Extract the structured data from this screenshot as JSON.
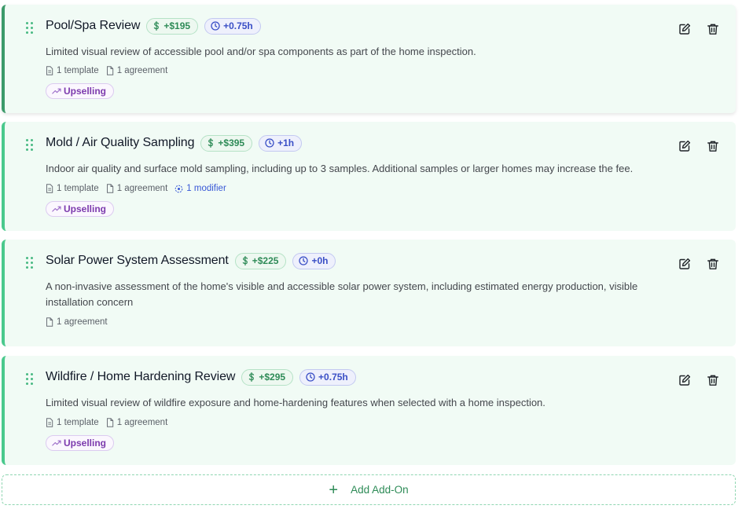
{
  "addons": [
    {
      "title": "Pool/Spa Review",
      "price": "+$195",
      "time": "+0.75h",
      "description": "Limited visual review of accessible pool and/or spa components as part of the home inspection.",
      "templates": "1 template",
      "agreements": "1 agreement",
      "modifiers": null,
      "tag": "Upselling"
    },
    {
      "title": "Mold / Air Quality Sampling",
      "price": "+$395",
      "time": "+1h",
      "description": "Indoor air quality and surface mold sampling, including up to 3 samples. Additional samples or larger homes may increase the fee.",
      "templates": "1 template",
      "agreements": "1 agreement",
      "modifiers": "1 modifier",
      "tag": "Upselling"
    },
    {
      "title": "Solar Power System Assessment",
      "price": "+$225",
      "time": "+0h",
      "description": "A non-invasive assessment of the home's visible and accessible solar power system, including estimated energy production, visible installation concern",
      "templates": null,
      "agreements": "1 agreement",
      "modifiers": null,
      "tag": null
    },
    {
      "title": "Wildfire / Home Hardening Review",
      "price": "+$295",
      "time": "+0.75h",
      "description": "Limited visual review of wildfire exposure and home-hardening features when selected with a home inspection.",
      "templates": "1 template",
      "agreements": "1 agreement",
      "modifiers": null,
      "tag": "Upselling"
    }
  ],
  "add_button_label": "Add Add-On",
  "icons": {
    "drag": "drag-handle-icon",
    "price": "dollar-icon",
    "time": "clock-icon",
    "template": "document-icon",
    "agreement": "file-icon",
    "modifier": "modifier-icon",
    "tag": "trending-up-icon",
    "edit": "edit-icon",
    "delete": "trash-icon",
    "add": "plus-icon"
  },
  "colors": {
    "card_bg": "#f1fbf5",
    "card_accent": "#4ac98d",
    "price_text": "#2e8b57",
    "time_text": "#3a4fc6",
    "tag_text": "#7c3aad",
    "modifier_text": "#3858d6"
  }
}
